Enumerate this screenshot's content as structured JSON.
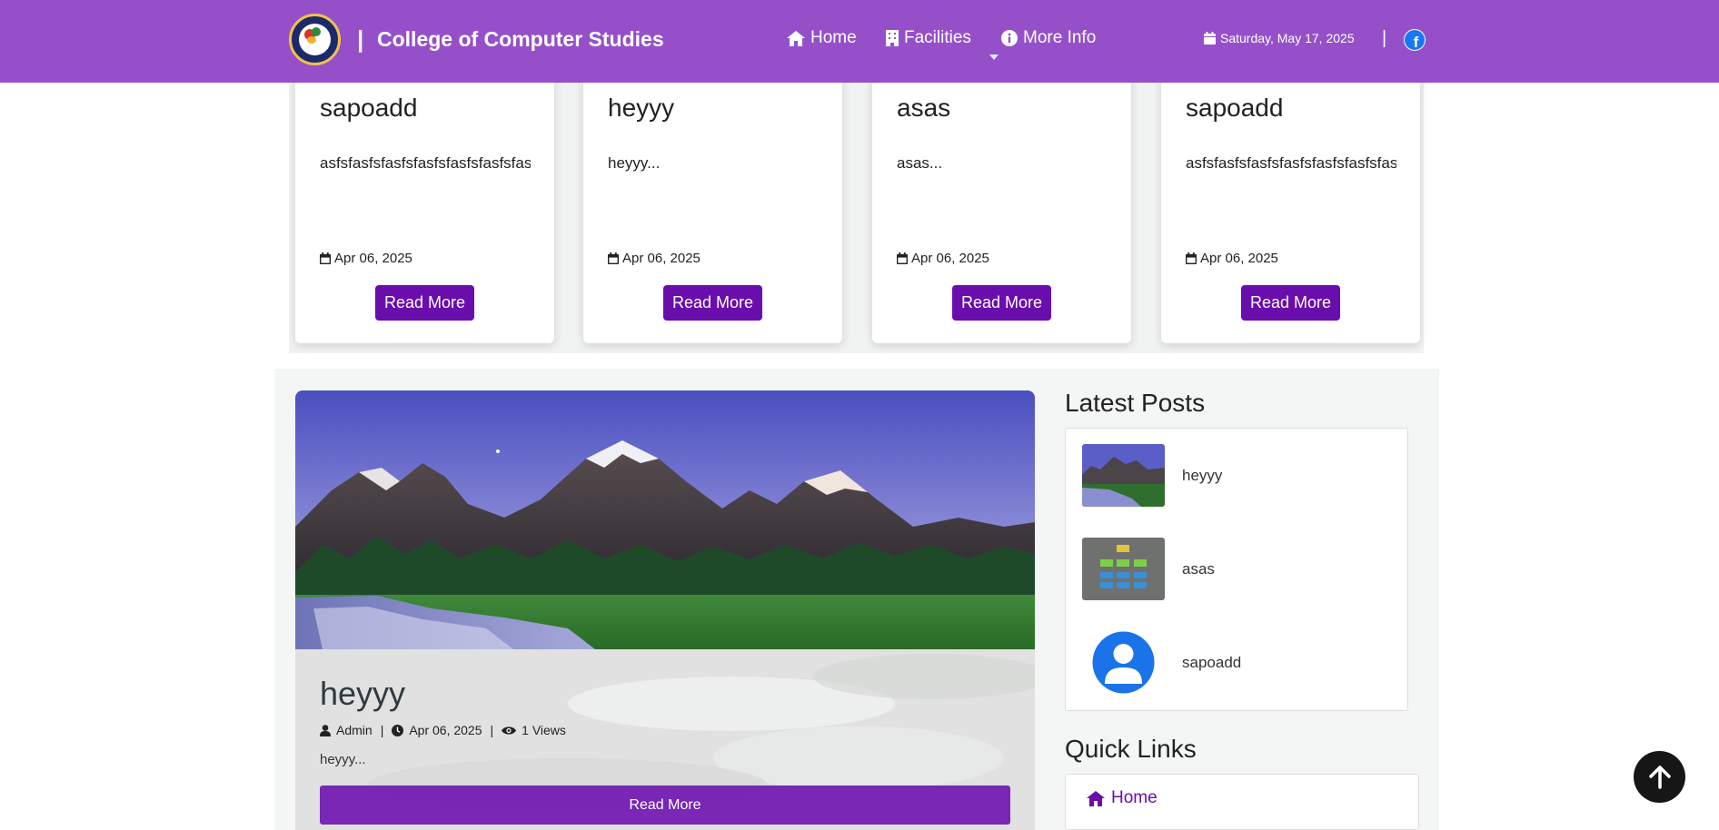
{
  "header": {
    "brand_separator": "|",
    "brand": "College of Computer Studies",
    "nav": {
      "home": "Home",
      "facilities": "Facilities",
      "more_info": "More Info"
    },
    "date": "Saturday, May 17, 2025",
    "separator": "|"
  },
  "cards": [
    {
      "title": "sapoadd",
      "excerpt": "asfsfasfsfasfsfasfsfasfsfasfsfasfsfasfsf",
      "date": "Apr 06, 2025",
      "button": "Read More"
    },
    {
      "title": "heyyy",
      "excerpt": "heyyy...",
      "date": "Apr 06, 2025",
      "button": "Read More"
    },
    {
      "title": "asas",
      "excerpt": "asas...",
      "date": "Apr 06, 2025",
      "button": "Read More"
    },
    {
      "title": "sapoadd",
      "excerpt": "asfsfasfsfasfsfasfsfasfsfasfsfasfsfasfsf",
      "date": "Apr 06, 2025",
      "button": "Read More"
    }
  ],
  "featured": {
    "title": "heyyy",
    "author": "Admin",
    "sep1": "|",
    "date": "Apr 06, 2025",
    "sep2": "|",
    "views": "1 Views",
    "excerpt": "heyyy...",
    "button": "Read More"
  },
  "sidebar": {
    "latest_heading": "Latest Posts",
    "latest_posts": [
      {
        "title": "heyyy"
      },
      {
        "title": "asas"
      },
      {
        "title": "sapoadd"
      }
    ],
    "quick_links_heading": "Quick Links",
    "quick_links": [
      {
        "label": "Home"
      }
    ]
  },
  "colors": {
    "navbar": "#9550c9",
    "accent": "#6a0dad",
    "facebook": "#1877f2"
  },
  "icons": {
    "nav_home": "home-icon",
    "nav_facilities": "building-icon",
    "nav_more": "info-circle-icon",
    "calendar": "calendar-icon",
    "facebook": "facebook-icon",
    "user": "user-icon",
    "clock": "clock-icon",
    "eye": "eye-icon",
    "back_to_top": "arrow-up-icon"
  }
}
